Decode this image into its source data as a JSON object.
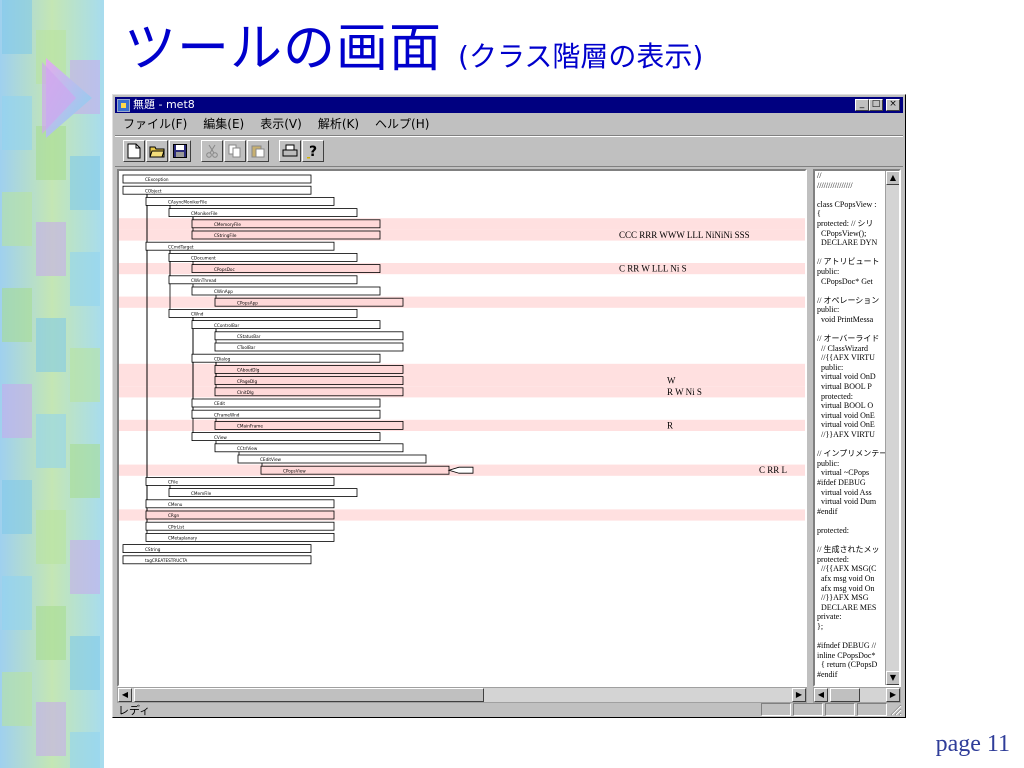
{
  "slide": {
    "title": "ツールの画面",
    "subtitle": "(クラス階層の表示)",
    "page_number": "page 11"
  },
  "window": {
    "title": "無題 - met8",
    "minimize_label": "_",
    "maximize_label": "□",
    "close_label": "×"
  },
  "menu": [
    {
      "label": "ファイル(F)"
    },
    {
      "label": "編集(E)"
    },
    {
      "label": "表示(V)"
    },
    {
      "label": "解析(K)"
    },
    {
      "label": "ヘルプ(H)"
    }
  ],
  "toolbar": [
    {
      "icon": "new-file-icon",
      "enabled": true
    },
    {
      "icon": "open-folder-icon",
      "enabled": true
    },
    {
      "icon": "save-icon",
      "enabled": true
    },
    {
      "icon": "cut-icon",
      "enabled": false
    },
    {
      "icon": "copy-icon",
      "enabled": false
    },
    {
      "icon": "paste-icon",
      "enabled": false
    },
    {
      "icon": "print-icon",
      "enabled": true
    },
    {
      "icon": "help-icon",
      "enabled": true
    }
  ],
  "tree": {
    "highlight_color": "#ffe0e0",
    "node_fill_highlight": "#ffd8d8",
    "nodes": [
      {
        "label": "CException",
        "depth": 0,
        "highlight": false
      },
      {
        "label": "CObject",
        "depth": 0,
        "highlight": false
      },
      {
        "label": "CAsyncMonikerFile",
        "depth": 1,
        "highlight": false
      },
      {
        "label": "CMonikerFile",
        "depth": 2,
        "highlight": false
      },
      {
        "label": "CMemoryFile",
        "depth": 3,
        "highlight": true
      },
      {
        "label": "CStringFile",
        "depth": 3,
        "highlight": true
      },
      {
        "label": "CCmdTarget",
        "depth": 1,
        "highlight": false
      },
      {
        "label": "CDocument",
        "depth": 2,
        "highlight": false
      },
      {
        "label": "CPopsDoc",
        "depth": 3,
        "highlight": true
      },
      {
        "label": "CWinThread",
        "depth": 2,
        "highlight": false
      },
      {
        "label": "CWinApp",
        "depth": 3,
        "highlight": false
      },
      {
        "label": "CPopsApp",
        "depth": 4,
        "highlight": true
      },
      {
        "label": "CWnd",
        "depth": 2,
        "highlight": false
      },
      {
        "label": "CControlBar",
        "depth": 3,
        "highlight": false
      },
      {
        "label": "CStatusBar",
        "depth": 4,
        "highlight": false
      },
      {
        "label": "CToolBar",
        "depth": 4,
        "highlight": false
      },
      {
        "label": "CDialog",
        "depth": 3,
        "highlight": false
      },
      {
        "label": "CAboutDlg",
        "depth": 4,
        "highlight": true
      },
      {
        "label": "CPageDlg",
        "depth": 4,
        "highlight": true
      },
      {
        "label": "CInitDlg",
        "depth": 4,
        "highlight": true
      },
      {
        "label": "CEdit",
        "depth": 3,
        "highlight": false
      },
      {
        "label": "CFrameWnd",
        "depth": 3,
        "highlight": false
      },
      {
        "label": "CMainFrame",
        "depth": 4,
        "highlight": true
      },
      {
        "label": "CView",
        "depth": 3,
        "highlight": false
      },
      {
        "label": "CCtrlView",
        "depth": 4,
        "highlight": false
      },
      {
        "label": "CEditView",
        "depth": 5,
        "highlight": false
      },
      {
        "label": "CPopsView",
        "depth": 6,
        "highlight": true
      },
      {
        "label": "CFile",
        "depth": 1,
        "highlight": false
      },
      {
        "label": "CMemFile",
        "depth": 2,
        "highlight": false
      },
      {
        "label": "CMenu",
        "depth": 1,
        "highlight": false
      },
      {
        "label": "CRgn",
        "depth": 1,
        "highlight": true
      },
      {
        "label": "CPtrList",
        "depth": 1,
        "highlight": false
      },
      {
        "label": "CMetaplanary",
        "depth": 1,
        "highlight": false
      },
      {
        "label": "CString",
        "depth": 0,
        "highlight": false
      },
      {
        "label": "tagCREATESTRUCTA",
        "depth": 0,
        "highlight": false
      }
    ],
    "annotations": [
      {
        "row": 5,
        "text": "CCC RRR WWW LLL   NiNiNi SSS"
      },
      {
        "row": 8,
        "text": "C RR W LLL   Ni S"
      },
      {
        "row": 18,
        "text": "W"
      },
      {
        "row": 19,
        "text": "R W    Ni S"
      },
      {
        "row": 22,
        "text": "R"
      },
      {
        "row": 26,
        "text": "C RR  L"
      }
    ]
  },
  "code_lines": [
    "//",
    "////////////////",
    "",
    "class CPopsView :",
    "{",
    "protected: // シリ",
    "  CPopsView();",
    "  DECLARE DYN",
    "",
    "// アトリビュート",
    "public:",
    "  CPopsDoc* Get",
    "",
    "// オペレーション",
    "public:",
    "  void PrintMessa",
    "",
    "// オーバーライド",
    "  // ClassWizard",
    "  //{{AFX VIRTU",
    "  public:",
    "  virtual void OnD",
    "  virtual BOOL P",
    "  protected:",
    "  virtual BOOL O",
    "  virtual void OnE",
    "  virtual void OnE",
    "  //}}AFX VIRTU",
    "",
    "// インプリメンテー",
    "public:",
    "  virtual ~CPops",
    "#ifdef DEBUG",
    "  virtual void Ass",
    "  virtual void Dum",
    "#endif",
    "",
    "protected:",
    "",
    "// 生成されたメッ",
    "protected:",
    "  //{{AFX MSG(C",
    "  afx msg void On",
    "  afx msg void On",
    "  //}}AFX MSG",
    "  DECLARE MES",
    "private:",
    "};",
    "",
    "#ifndef DEBUG //",
    "inline CPopsDoc*",
    "  { return (CPopsD",
    "#endif",
    "",
    "////////////////"
  ],
  "status": {
    "text": "レディ"
  }
}
